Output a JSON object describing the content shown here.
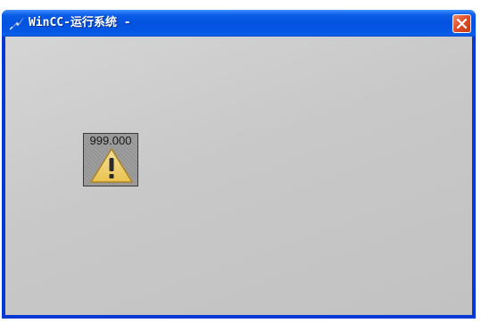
{
  "window": {
    "title": "WinCC-运行系统 - ",
    "app_icon": "wincc-runtime-icon",
    "close_icon": "close-icon",
    "colors": {
      "titlebar": "#0453e0",
      "close_button": "#e0502a",
      "client_background": "#c8c8c8"
    }
  },
  "io_field": {
    "value": "999.000",
    "overlay_icon": "warning-icon",
    "colors": {
      "warning_fill": "#f2c64a",
      "warning_outline": "#b08418"
    }
  }
}
